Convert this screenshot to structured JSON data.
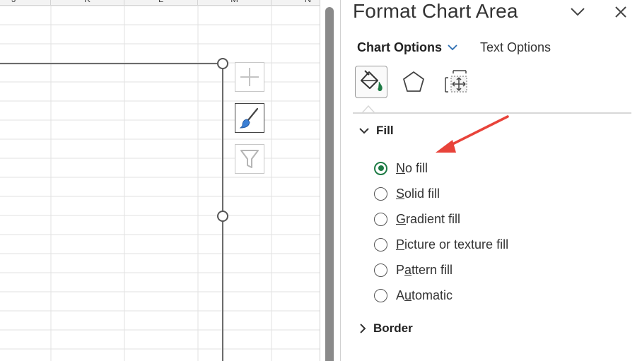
{
  "sheet": {
    "column_headers": [
      "J",
      "K",
      "L",
      "M",
      "N"
    ]
  },
  "chart_elements": {
    "add_element_icon": "plus-icon",
    "styles_icon": "brush-icon",
    "filters_icon": "funnel-icon"
  },
  "pane": {
    "title": "Format Chart Area",
    "tabs": {
      "chart_options": "Chart Options",
      "text_options": "Text Options"
    },
    "icon_tabs": [
      "fill-line-icon",
      "effects-pentagon-icon",
      "size-properties-icon"
    ],
    "fill_section": {
      "label": "Fill",
      "expanded": true,
      "options": [
        {
          "accel": "N",
          "rest": "o fill",
          "label": "No fill",
          "checked": true
        },
        {
          "accel": "S",
          "rest": "olid fill",
          "label": "Solid fill",
          "checked": false
        },
        {
          "accel": "G",
          "rest": "radient fill",
          "label": "Gradient fill",
          "checked": false
        },
        {
          "accel": "P",
          "rest": "icture or texture fill",
          "label": "Picture or texture fill",
          "checked": false
        },
        {
          "pre": "P",
          "accel": "a",
          "rest": "ttern fill",
          "label": "Pattern fill",
          "checked": false
        },
        {
          "pre": "A",
          "accel": "u",
          "rest": "tomatic",
          "label": "Automatic",
          "checked": false
        }
      ]
    },
    "border_section": {
      "label": "Border",
      "expanded": false
    }
  },
  "colors": {
    "accent_green": "#1e7b45",
    "annotation_arrow": "#e8433a",
    "chevron_blue": "#2b6cb0"
  }
}
